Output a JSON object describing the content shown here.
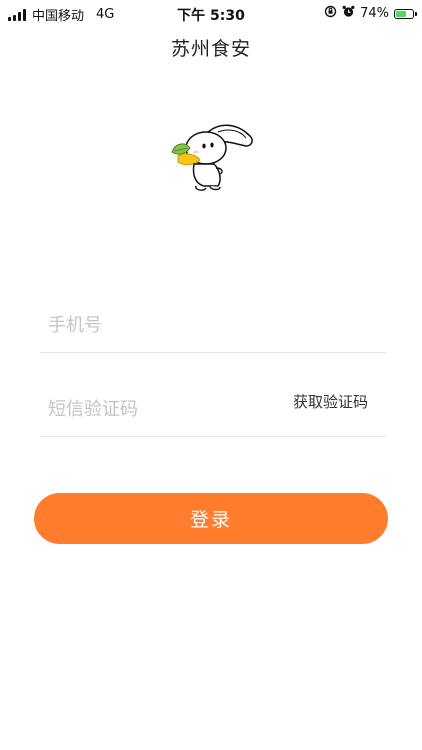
{
  "status_bar": {
    "carrier": "中国移动",
    "network": "4G",
    "time": "下午 5:30",
    "battery_percent": "74%",
    "battery_level": 0.74,
    "battery_color": "#4cd964"
  },
  "header": {
    "title": "苏州食安"
  },
  "mascot": {
    "icon": "rabbit-mascot-icon"
  },
  "form": {
    "phone_placeholder": "手机号",
    "code_placeholder": "短信验证码",
    "get_code_label": "获取验证码"
  },
  "login": {
    "label": "登录",
    "color": "#ff7d2d"
  }
}
